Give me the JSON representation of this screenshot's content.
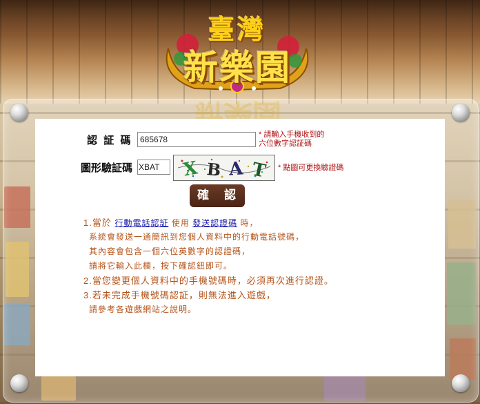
{
  "logo": {
    "line1": "臺灣",
    "line2": "新樂園"
  },
  "form": {
    "code_label": "認 証 碼",
    "code_value": "685678",
    "code_hint_line1": "* 請輸入手機收到的",
    "code_hint_line2": "六位數字認証碼",
    "captcha_label": "圖形驗証碼",
    "captcha_value": "XBAT",
    "captcha_image_text": [
      "X",
      "B",
      "A",
      "T"
    ],
    "captcha_hint": "* 點圖可更換驗證碼",
    "confirm_label": "確 認"
  },
  "notes": {
    "line1_prefix": "1.當於 ",
    "line1_link1": "行動電話認証",
    "line1_middle": " 使用 ",
    "line1_link2": "發送認證碼",
    "line1_suffix": " 時，",
    "line2": "系統會發送一通簡訊到您個人資料中的行動電話號碼，",
    "line3": "其內容會包含一個六位英數字的認證碼，",
    "line4": "請將它輸入此欄，按下確認鈕即可。",
    "line5": "2.當您變更個人資料中的手機號碼時，必須再次進行認證。",
    "line6": "3.若未完成手機號碼認証，則無法進入遊戲，",
    "line7": "請參考各遊戲網站之說明。"
  },
  "colors": {
    "note_text": "#b5541a",
    "link": "#1a1aa8",
    "hint": "#b01010",
    "button": "#4a2414"
  }
}
